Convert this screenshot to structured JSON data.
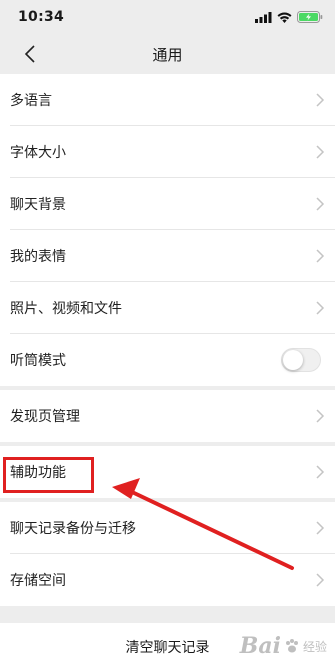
{
  "status_bar": {
    "time": "10:34",
    "signal_icon": "cellular-signal-icon",
    "wifi_icon": "wifi-icon",
    "battery_icon": "battery-charging-icon",
    "battery_color": "#4cd964"
  },
  "nav": {
    "back_icon": "chevron-left-icon",
    "title": "通用"
  },
  "menu_items": [
    {
      "label": "多语言",
      "control": "chevron"
    },
    {
      "label": "字体大小",
      "control": "chevron"
    },
    {
      "label": "聊天背景",
      "control": "chevron"
    },
    {
      "label": "我的表情",
      "control": "chevron"
    },
    {
      "label": "照片、视频和文件",
      "control": "chevron"
    },
    {
      "label": "听筒模式",
      "control": "toggle",
      "toggle_on": false
    },
    {
      "label": "发现页管理",
      "control": "chevron"
    },
    {
      "label": "辅助功能",
      "control": "chevron",
      "highlighted": true
    },
    {
      "label": "聊天记录备份与迁移",
      "control": "chevron"
    },
    {
      "label": "存储空间",
      "control": "chevron"
    }
  ],
  "footer": {
    "clear_chat_label": "清空聊天记录"
  },
  "annotation": {
    "highlight_color": "#e02020",
    "arrow_color": "#e02020"
  },
  "watermark": {
    "brand": "Bai",
    "suffix": "经验",
    "logo_icon": "paw-icon"
  }
}
